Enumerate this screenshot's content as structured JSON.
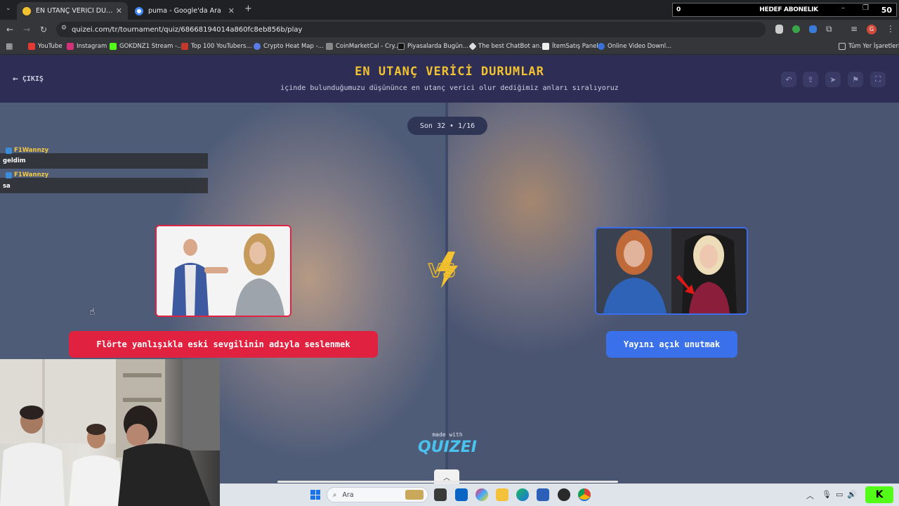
{
  "browser": {
    "tabs": [
      {
        "label": "EN UTANÇ VERİCİ DURUMLAR",
        "active": true
      },
      {
        "label": "puma - Google'da Ara",
        "active": false
      }
    ],
    "url": "quizei.com/tr/tournament/quiz/68668194014a860fc8eb856b/play",
    "bookmarks": [
      "YouTube",
      "Instagram",
      "GOKDNZ1 Stream -...",
      "Top 100 YouTubers...",
      "Crypto Heat Map -...",
      "CoinMarketCal - Cry...",
      "Piyasalarda Bugün...",
      "The best ChatBot an...",
      "İtemSatış Panel",
      "Online Video Downl..."
    ],
    "all_bookmarks": "Tüm Yer İşaretleri"
  },
  "goal_widget": {
    "left": "0",
    "label": "HEDEF ABONELIK",
    "right": "50"
  },
  "header": {
    "exit_label": "ÇIKIŞ",
    "title": "EN UTANÇ VERİCİ DURUMLAR",
    "subtitle": "içinde bulunduğumuzu düşününce en utanç verici olur dediğimiz anları sıralıyoruz"
  },
  "round_badge": "Son 32 • 1/16",
  "chat": [
    {
      "user": "F1Wannzy",
      "message": "geldim"
    },
    {
      "user": "F1Wannzy",
      "message": "sa"
    }
  ],
  "options": {
    "left": {
      "label": "Flörte yanlışıkla eski sevgilinin adıyla seslenmek",
      "color": "#e0213f"
    },
    "right": {
      "label": "Yayını açık unutmak",
      "color": "#3a70ea"
    }
  },
  "vs_label": "VS",
  "footer": {
    "made_with": "made with",
    "brand": "QUIZEI"
  },
  "taskbar": {
    "search_placeholder": "Ara"
  }
}
